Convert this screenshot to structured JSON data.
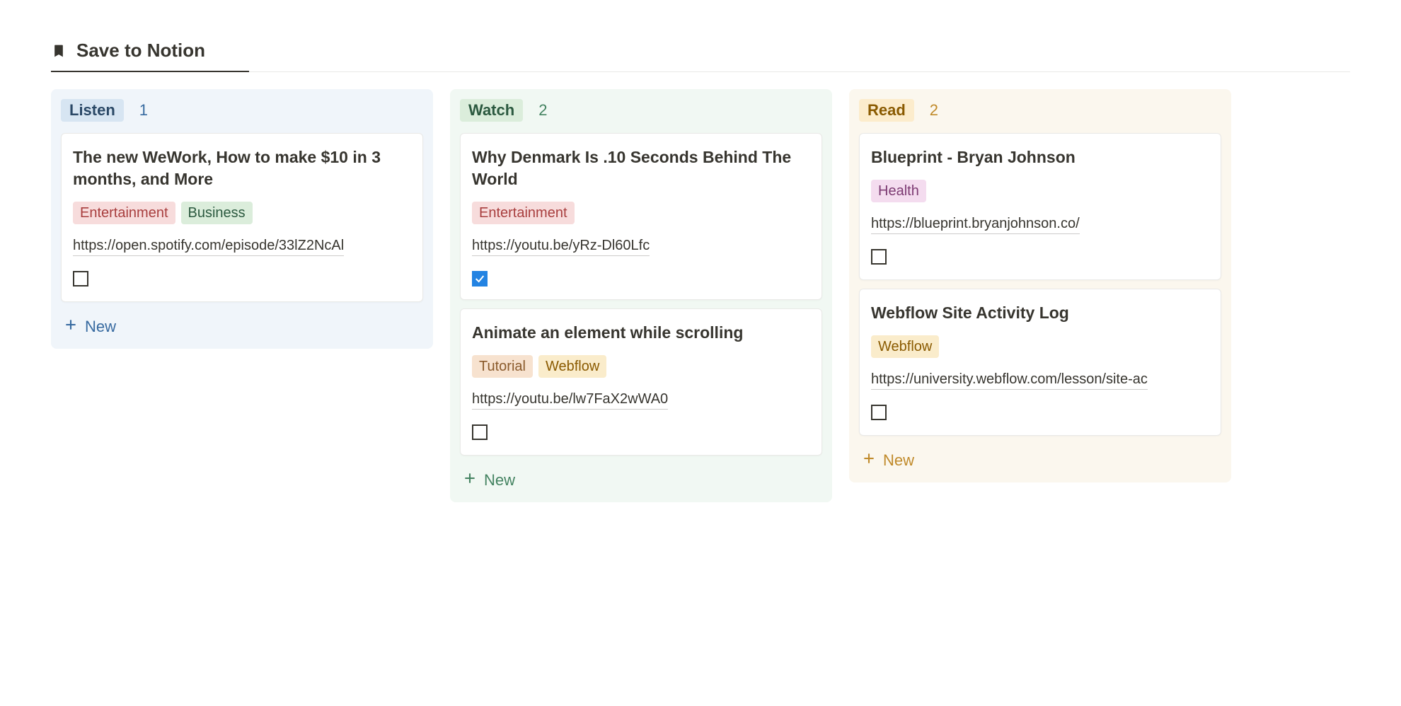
{
  "page": {
    "title": "Save to Notion"
  },
  "columns": {
    "listen": {
      "label": "Listen",
      "count": "1",
      "new_label": "New",
      "cards": [
        {
          "title": "The new WeWork, How to make $10 in 3 months, and More",
          "tags": [
            {
              "label": "Entertainment",
              "style": "entertainment"
            },
            {
              "label": "Business",
              "style": "business"
            }
          ],
          "url": "https://open.spotify.com/episode/33lZ2NcAl",
          "checked": false
        }
      ]
    },
    "watch": {
      "label": "Watch",
      "count": "2",
      "new_label": "New",
      "cards": [
        {
          "title": "Why Denmark Is .10 Seconds Behind The World",
          "tags": [
            {
              "label": "Entertainment",
              "style": "entertainment"
            }
          ],
          "url": "https://youtu.be/yRz-Dl60Lfc",
          "checked": true
        },
        {
          "title": "Animate an element while scrolling",
          "tags": [
            {
              "label": "Tutorial",
              "style": "tutorial"
            },
            {
              "label": "Webflow",
              "style": "webflow"
            }
          ],
          "url": "https://youtu.be/lw7FaX2wWA0",
          "checked": false
        }
      ]
    },
    "read": {
      "label": "Read",
      "count": "2",
      "new_label": "New",
      "cards": [
        {
          "title": "Blueprint - Bryan Johnson",
          "tags": [
            {
              "label": "Health",
              "style": "health"
            }
          ],
          "url": "https://blueprint.bryanjohnson.co/",
          "checked": false
        },
        {
          "title": "Webflow Site Activity Log",
          "tags": [
            {
              "label": "Webflow",
              "style": "webflow"
            }
          ],
          "url": "https://university.webflow.com/lesson/site-ac",
          "checked": false
        }
      ]
    }
  }
}
